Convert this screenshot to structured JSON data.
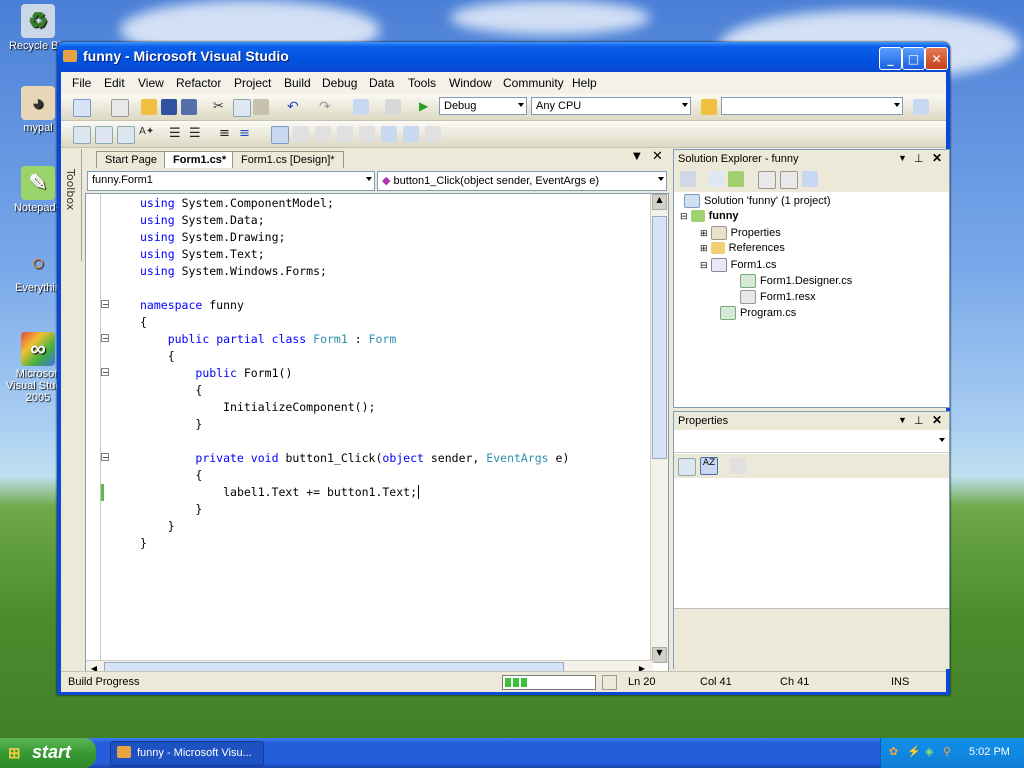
{
  "desktop": {
    "icons": [
      {
        "label": "Recycle Bin"
      },
      {
        "label": "mypal"
      },
      {
        "label": "Notepad+"
      },
      {
        "label": "Everythin"
      },
      {
        "label": "Microsoft Visual Studio 2005"
      }
    ]
  },
  "window": {
    "title": "funny - Microsoft Visual Studio",
    "minimize_icon": "minimize-icon",
    "maximize_icon": "maximize-icon",
    "close_icon": "close-icon"
  },
  "menubar": {
    "items": [
      "File",
      "Edit",
      "View",
      "Refactor",
      "Project",
      "Build",
      "Debug",
      "Data",
      "Tools",
      "Window",
      "Community",
      "Help"
    ]
  },
  "toolbar": {
    "config": "Debug",
    "platform": "Any CPU",
    "find_value": ""
  },
  "toolbox": {
    "label": "Toolbox"
  },
  "tabs": [
    {
      "label": "Start Page",
      "active": false
    },
    {
      "label": "Form1.cs*",
      "active": true
    },
    {
      "label": "Form1.cs [Design]*",
      "active": false
    }
  ],
  "nav": {
    "class_combo": "funny.Form1",
    "member_combo": "button1_Click(object sender, EventArgs e)"
  },
  "code": {
    "lines": [
      "using System.ComponentModel;",
      "using System.Data;",
      "using System.Drawing;",
      "using System.Text;",
      "using System.Windows.Forms;",
      "",
      "namespace funny",
      "{",
      "    public partial class Form1 : Form",
      "    {",
      "        public Form1()",
      "        {",
      "            InitializeComponent();",
      "        }",
      "",
      "        private void button1_Click(object sender, EventArgs e)",
      "        {",
      "            label1.Text += button1.Text;",
      "        }",
      "    }",
      "}"
    ]
  },
  "solution_explorer": {
    "title": "Solution Explorer - funny",
    "items": [
      {
        "label": "Solution 'funny' (1 project)"
      },
      {
        "label": "funny"
      },
      {
        "label": "Properties"
      },
      {
        "label": "References"
      },
      {
        "label": "Form1.cs"
      },
      {
        "label": "Form1.Designer.cs"
      },
      {
        "label": "Form1.resx"
      },
      {
        "label": "Program.cs"
      }
    ]
  },
  "properties": {
    "title": "Properties"
  },
  "status": {
    "build": "Build Progress",
    "ln": "Ln 20",
    "col": "Col 41",
    "ch": "Ch 41",
    "mode": "INS",
    "progress": 0.25
  },
  "taskbar": {
    "start": "start",
    "task": "funny - Microsoft Visu...",
    "clock": "5:02 PM"
  }
}
